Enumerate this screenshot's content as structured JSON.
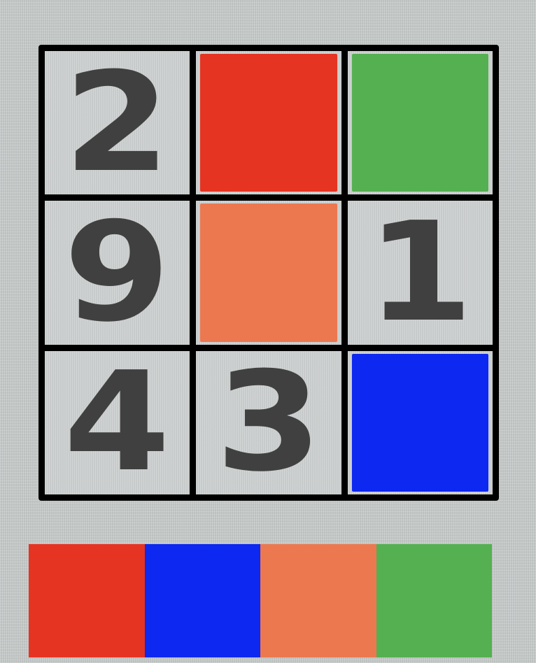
{
  "board": {
    "cells": [
      {
        "number": "2",
        "color": ""
      },
      {
        "number": "",
        "color": "#e63422"
      },
      {
        "number": "",
        "color": "#55b051"
      },
      {
        "number": "9",
        "color": ""
      },
      {
        "number": "",
        "color": "#ec7850"
      },
      {
        "number": "1",
        "color": ""
      },
      {
        "number": "4",
        "color": ""
      },
      {
        "number": "3",
        "color": ""
      },
      {
        "number": "",
        "color": "#0d28f0"
      }
    ]
  },
  "palette": {
    "swatches": [
      {
        "color": "#e63422",
        "name": "red"
      },
      {
        "color": "#0d28f0",
        "name": "blue"
      },
      {
        "color": "#ec7850",
        "name": "orange"
      },
      {
        "color": "#55b051",
        "name": "green"
      }
    ]
  },
  "colors": {
    "background": "#c9cdcc",
    "grid_line": "#000000",
    "digit": "#404040"
  }
}
